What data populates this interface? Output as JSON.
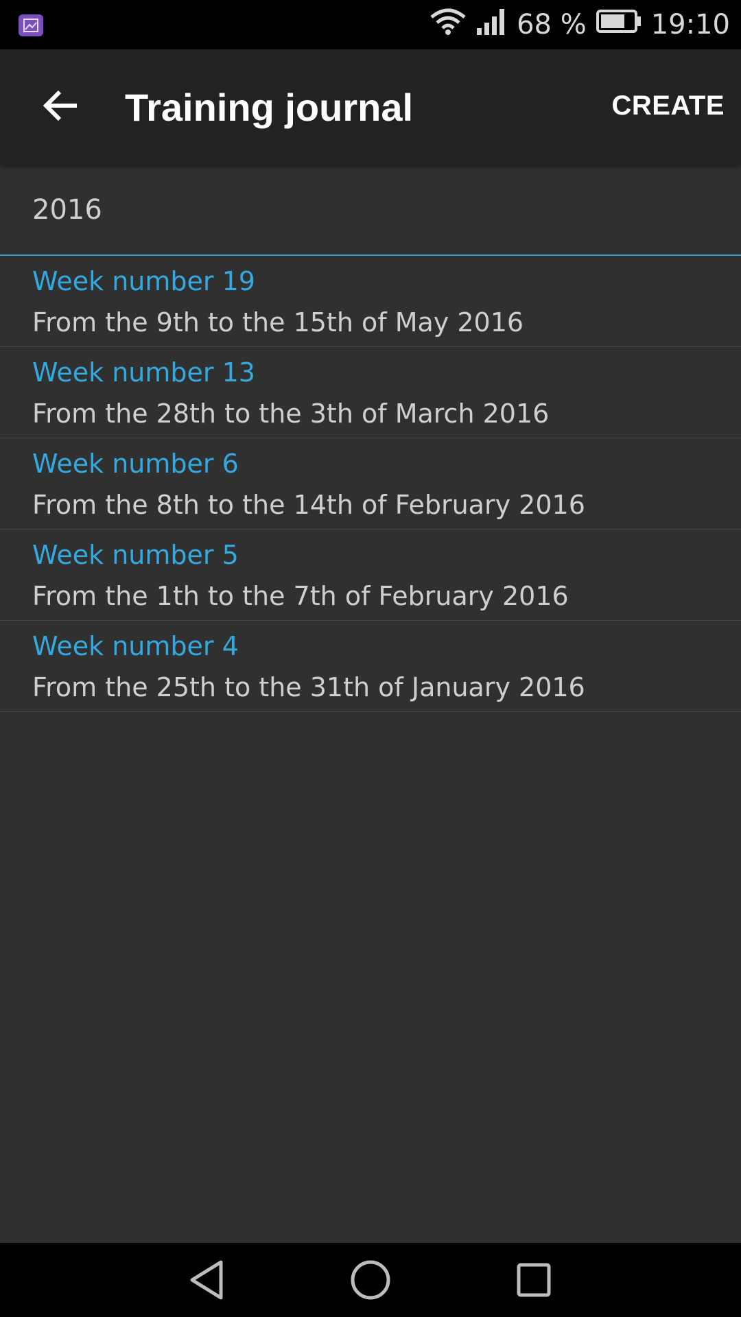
{
  "status_bar": {
    "battery_percent": "68 %",
    "time": "19:10",
    "icons": [
      "gallery-notification-icon",
      "wifi-icon",
      "signal-icon",
      "battery-icon"
    ]
  },
  "app_bar": {
    "title": "Training journal",
    "action_label": "CREATE",
    "back_icon": "arrow-left-icon"
  },
  "content": {
    "year": "2016",
    "weeks": [
      {
        "title": "Week number 19",
        "range": "From the 9th to the 15th of May 2016"
      },
      {
        "title": "Week number 13",
        "range": "From the 28th to the 3th of March 2016"
      },
      {
        "title": "Week number 6",
        "range": "From the 8th to the 14th of February 2016"
      },
      {
        "title": "Week number 5",
        "range": "From the 1th to the 7th of February 2016"
      },
      {
        "title": "Week number 4",
        "range": "From the 25th to the 31th of January 2016"
      }
    ]
  },
  "colors": {
    "accent": "#34a9df",
    "background": "#303030",
    "app_bar": "#222222"
  },
  "nav_bar": {
    "icons": [
      "back-triangle-icon",
      "home-circle-icon",
      "recents-square-icon"
    ]
  }
}
